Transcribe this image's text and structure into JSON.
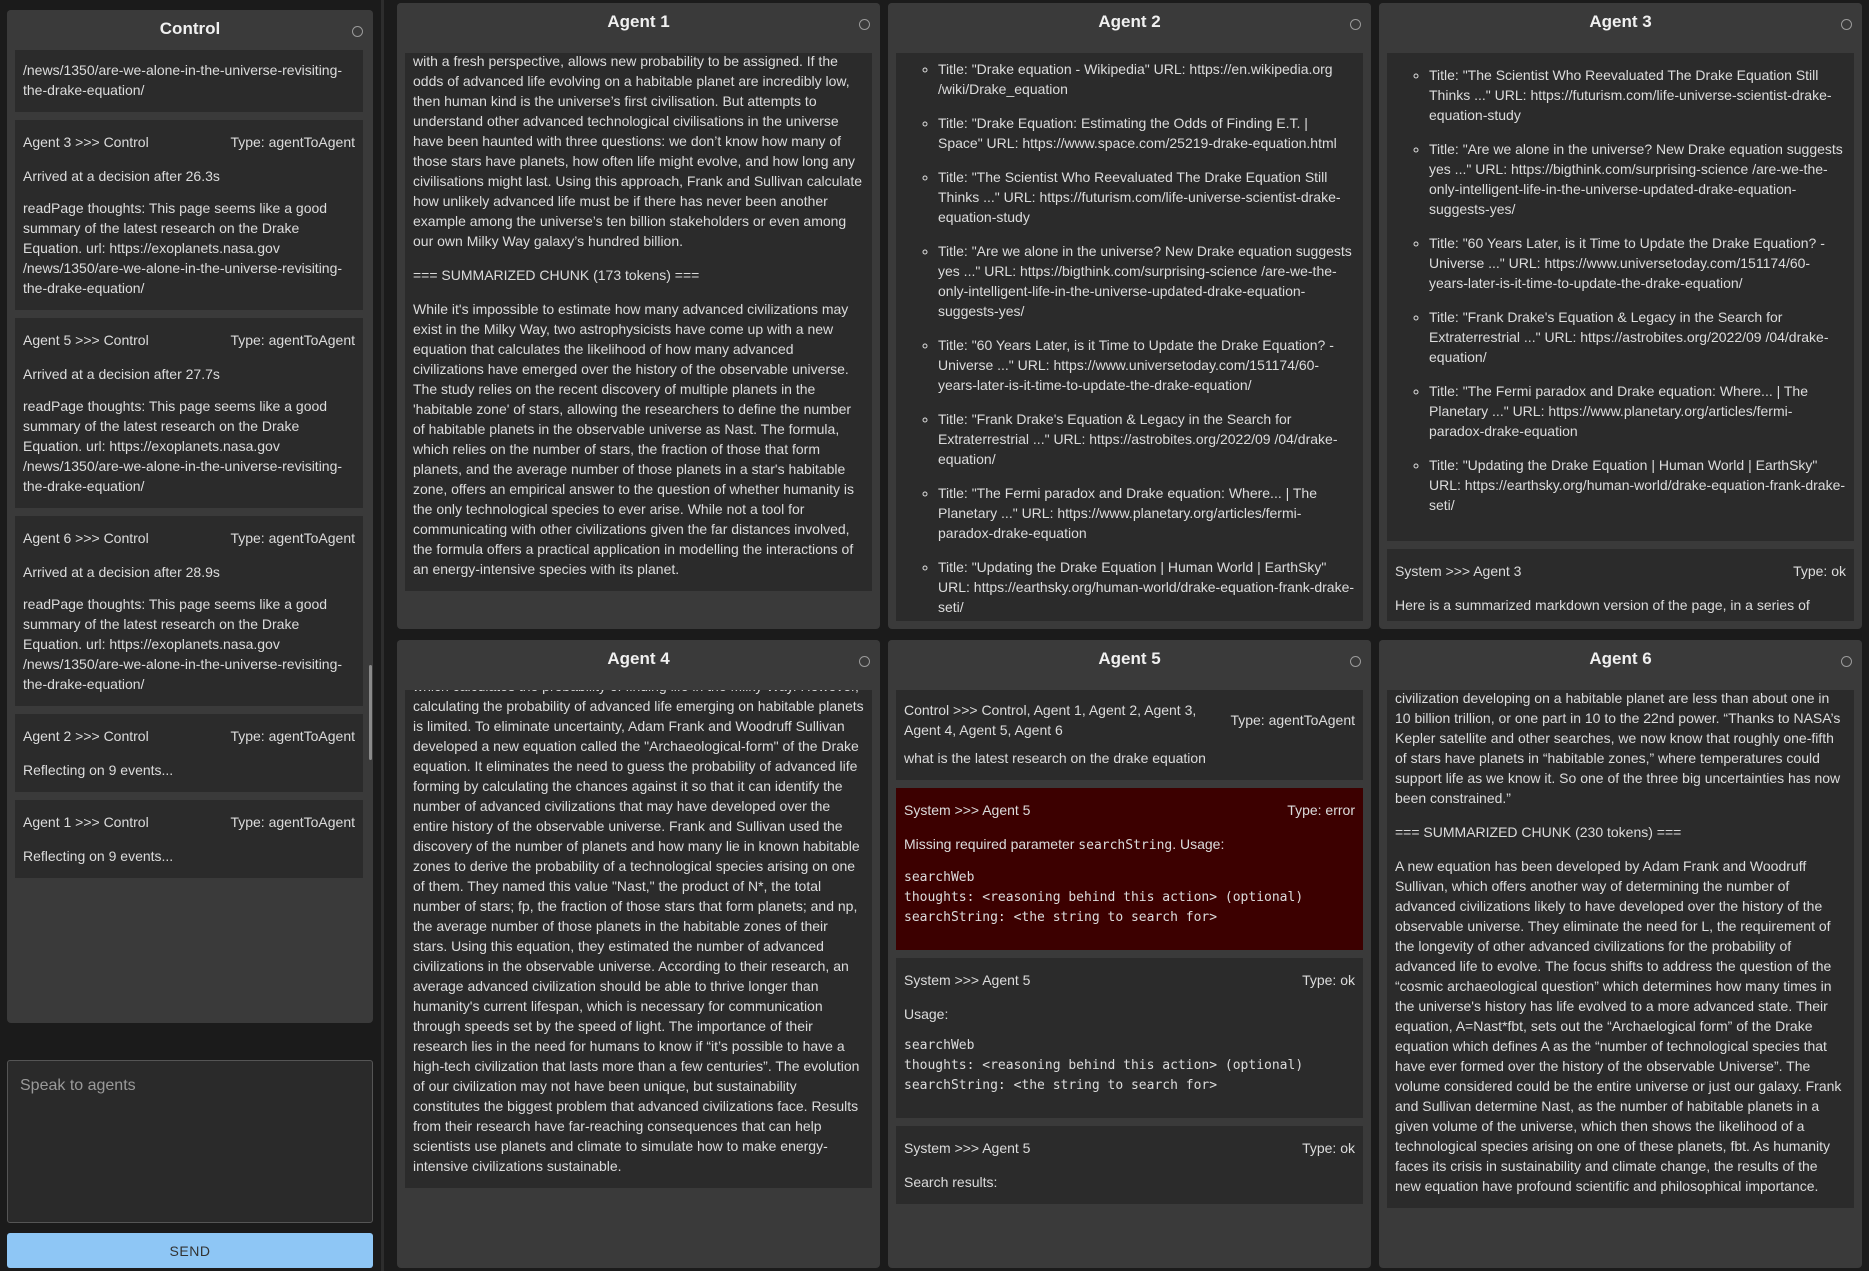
{
  "control": {
    "title": "Control",
    "messages": [
      {
        "partial": true,
        "lines": [
          "/news/1350/are-we-alone-in-the-universe-revisiting-the-drake-equation/"
        ]
      },
      {
        "from": "Agent 3 >>> Control",
        "type": "Type: agentToAgent",
        "lines": [
          "Arrived at a decision after 26.3s",
          "readPage thoughts: This page seems like a good summary of the latest research on the Drake Equation. url: https://exoplanets.nasa.gov /news/1350/are-we-alone-in-the-universe-revisiting-the-drake-equation/"
        ]
      },
      {
        "from": "Agent 5 >>> Control",
        "type": "Type: agentToAgent",
        "lines": [
          "Arrived at a decision after 27.7s",
          "readPage thoughts: This page seems like a good summary of the latest research on the Drake Equation. url: https://exoplanets.nasa.gov /news/1350/are-we-alone-in-the-universe-revisiting-the-drake-equation/"
        ]
      },
      {
        "from": "Agent 6 >>> Control",
        "type": "Type: agentToAgent",
        "lines": [
          "Arrived at a decision after 28.9s",
          "readPage thoughts: This page seems like a good summary of the latest research on the Drake Equation. url: https://exoplanets.nasa.gov /news/1350/are-we-alone-in-the-universe-revisiting-the-drake-equation/"
        ]
      },
      {
        "from": "Agent 2 >>> Control",
        "type": "Type: agentToAgent",
        "lines": [
          "Reflecting on 9 events..."
        ]
      },
      {
        "from": "Agent 1 >>> Control",
        "type": "Type: agentToAgent",
        "lines": [
          "Reflecting on 9 events..."
        ]
      }
    ],
    "input_placeholder": "Speak to agents",
    "send_label": "SEND"
  },
  "agent1": {
    "title": "Agent 1",
    "paragraphs": [
      "with a fresh perspective, allows new probability to be assigned. If the odds of advanced life evolving on a habitable planet are incredibly low, then human kind is the universe’s first civilisation. But attempts to understand other advanced technological civilisations in the universe have been haunted with three questions: we don’t know how many of those stars have planets, how often life might evolve, and how long any civilisations might last. Using this approach, Frank and Sullivan calculate how unlikely advanced life must be if there has never been another example among the universe’s ten billion stakeholders or even among our own Milky Way galaxy’s hundred billion.",
      "=== SUMMARIZED CHUNK (173 tokens) ===",
      "While it's impossible to estimate how many advanced civilizations may exist in the Milky Way, two astrophysicists have come up with a new equation that calculates the likelihood of how many advanced civilizations have emerged over the history of the observable universe. The study relies on the recent discovery of multiple planets in the 'habitable zone' of stars, allowing the researchers to define the number of habitable planets in the observable universe as Nast. The formula, which relies on the number of stars, the fraction of those that form planets, and the average number of those planets in a star's habitable zone, offers an empirical answer to the question of whether humanity is the only technological species to ever arise. While not a tool for communicating with other civilizations given the far distances involved, the formula offers a practical application in modelling the interactions of an energy-intensive species with its planet."
    ]
  },
  "agent2": {
    "title": "Agent 2",
    "results": [
      "Title: \"Drake equation - Wikipedia\" URL: https://en.wikipedia.org /wiki/Drake_equation",
      "Title: \"Drake Equation: Estimating the Odds of Finding E.T. | Space\" URL: https://www.space.com/25219-drake-equation.html",
      "Title: \"The Scientist Who Reevaluated The Drake Equation Still Thinks ...\" URL: https://futurism.com/life-universe-scientist-drake-equation-study",
      "Title: \"Are we alone in the universe? New Drake equation suggests yes ...\" URL: https://bigthink.com/surprising-science /are-we-the-only-intelligent-life-in-the-universe-updated-drake-equation-suggests-yes/",
      "Title: \"60 Years Later, is it Time to Update the Drake Equation? - Universe ...\" URL: https://www.universetoday.com/151174/60-years-later-is-it-time-to-update-the-drake-equation/",
      "Title: \"Frank Drake's Equation & Legacy in the Search for Extraterrestrial ...\" URL: https://astrobites.org/2022/09 /04/drake-equation/",
      "Title: \"The Fermi paradox and Drake equation: Where... | The Planetary ...\" URL: https://www.planetary.org/articles/fermi-paradox-drake-equation",
      "Title: \"Updating the Drake Equation | Human World | EarthSky\" URL: https://earthsky.org/human-world/drake-equation-frank-drake-seti/"
    ]
  },
  "agent3": {
    "title": "Agent 3",
    "results": [
      "Title: \"The Scientist Who Reevaluated The Drake Equation Still Thinks ...\" URL: https://futurism.com/life-universe-scientist-drake-equation-study",
      "Title: \"Are we alone in the universe? New Drake equation suggests yes ...\" URL: https://bigthink.com/surprising-science /are-we-the-only-intelligent-life-in-the-universe-updated-drake-equation-suggests-yes/",
      "Title: \"60 Years Later, is it Time to Update the Drake Equation? - Universe ...\" URL: https://www.universetoday.com/151174/60-years-later-is-it-time-to-update-the-drake-equation/",
      "Title: \"Frank Drake's Equation & Legacy in the Search for Extraterrestrial ...\" URL: https://astrobites.org/2022/09 /04/drake-equation/",
      "Title: \"The Fermi paradox and Drake equation: Where... | The Planetary ...\" URL: https://www.planetary.org/articles/fermi-paradox-drake-equation",
      "Title: \"Updating the Drake Equation | Human World | EarthSky\" URL: https://earthsky.org/human-world/drake-equation-frank-drake-seti/"
    ],
    "system_msg": {
      "from": "System >>> Agent 3",
      "type": "Type: ok",
      "text": "Here is a summarized markdown version of the page, in a series of"
    }
  },
  "agent4": {
    "title": "Agent 4",
    "paragraphs": [
      "which calculates the probability of finding life in the Milky Way. However, calculating the probability of advanced life emerging on habitable planets is limited. To eliminate uncertainty, Adam Frank and Woodruff Sullivan developed a new equation called the \"Archaeological-form\" of the Drake equation. It eliminates the need to guess the probability of advanced life forming by calculating the chances against it so that it can identify the number of advanced civilizations that may have developed over the entire history of the observable universe. Frank and Sullivan used the discovery of the number of planets and how many lie in known habitable zones to derive the probability of a technological species arising on one of them. They named this value \"Nast,\" the product of N*, the total number of stars; fp, the fraction of those stars that form planets; and np, the average number of those planets in the habitable zones of their stars. Using this equation, they estimated the number of advanced civilizations in the observable universe. According to their research, an average advanced civilization should be able to thrive longer than humanity's current lifespan, which is necessary for communication through speeds set by the speed of light. The importance of their research lies in the need for humans to know if “it’s possible to have a high-tech civilization that lasts more than a few centuries”. The evolution of our civilization may not have been unique, but sustainability constitutes the biggest problem that advanced civilizations face. Results from their research have far-reaching consequences that can help scientists use planets and climate to simulate how to make energy-intensive civilizations sustainable."
    ]
  },
  "agent5": {
    "title": "Agent 5",
    "messages": [
      {
        "from": "Control >>> Control, Agent 1, Agent 2, Agent 3, Agent 4, Agent 5, Agent 6",
        "type": "Type: agentToAgent",
        "text": "what is the latest research on the drake equation",
        "error": false
      },
      {
        "from": "System >>> Agent 5",
        "type": "Type: error",
        "text_pre": "Missing required parameter ",
        "text_code": "searchString",
        "text_post": ". Usage:",
        "code": "searchWeb\nthoughts: <reasoning behind this action> (optional)\nsearchString: <the string to search for>",
        "error": true
      },
      {
        "from": "System >>> Agent 5",
        "type": "Type: ok",
        "text": "Usage:",
        "code": "searchWeb\nthoughts: <reasoning behind this action> (optional)\nsearchString: <the string to search for>",
        "error": false
      },
      {
        "from": "System >>> Agent 5",
        "type": "Type: ok",
        "text": "Search results:",
        "error": false
      }
    ]
  },
  "agent6": {
    "title": "Agent 6",
    "paragraphs": [
      "civilization developing on a habitable planet are less than about one in 10 billion trillion, or one part in 10 to the 22nd power. “Thanks to NASA’s Kepler satellite and other searches, we now know that roughly one-fifth of stars have planets in “habitable zones,” where temperatures could support life as we know it. So one of the three big uncertainties has now been constrained.”",
      "=== SUMMARIZED CHUNK (230 tokens) ===",
      "A new equation has been developed by Adam Frank and Woodruff Sullivan, which offers another way of determining the number of advanced civilizations likely to have developed over the history of the observable universe. They eliminate the need for L, the requirement of the longevity of other advanced civilizations for the probability of advanced life to evolve. The focus shifts to address the question of the “cosmic archaeological question” which determines how many times in the universe's history has life evolved to a more advanced state. Their equation, A=Nast*fbt, sets out the “Archaelogical form” of the Drake equation which defines A as the “number of technological species that have ever formed over the history of the observable Universe”. The volume considered could be the entire universe or just our galaxy. Frank and Sullivan determine Nast, as the number of habitable planets in a given volume of the universe, which then shows the likelihood of a technological species arising on one of these planets, fbt. As humanity faces its crisis in sustainability and climate change, the results of the new equation have profound scientific and philosophical importance."
    ]
  }
}
